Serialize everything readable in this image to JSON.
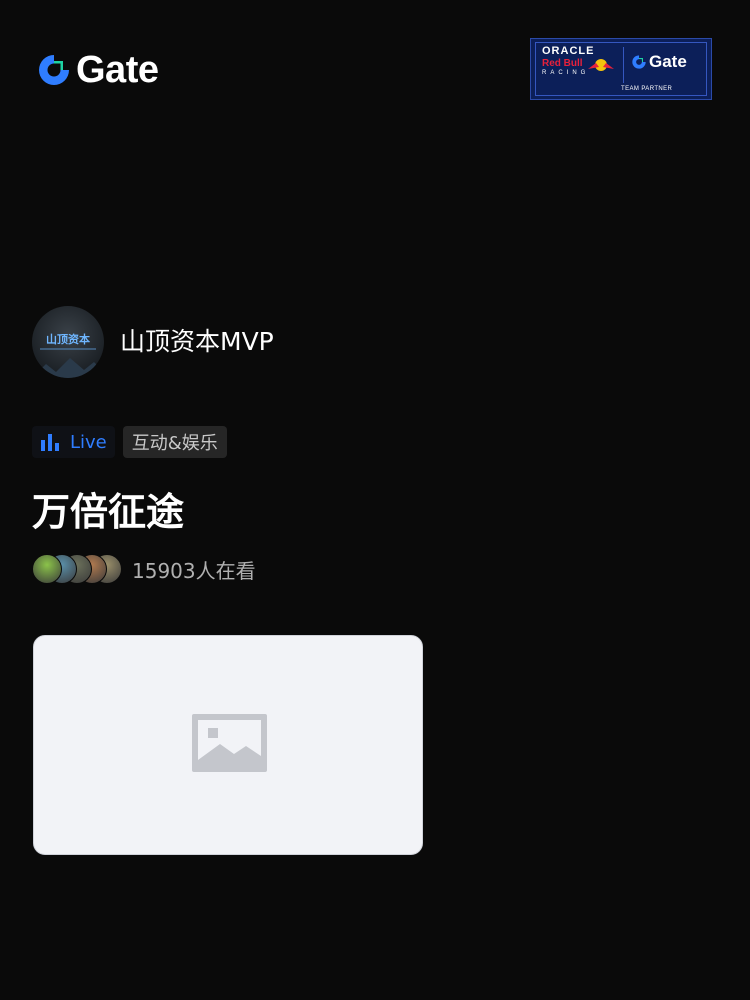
{
  "brand": {
    "name": "Gate",
    "accent": "#2f7dff",
    "mark_color": "#2f7dff",
    "mark_inner": "#1dd3a3"
  },
  "partner": {
    "oracle": "ORACLE",
    "redbull": "Red Bull",
    "racing": "RACING",
    "gate": "Gate",
    "team": "TEAM PARTNER"
  },
  "host": {
    "name": "山顶资本MVP",
    "avatar_title": "山顶资本"
  },
  "tags": {
    "live": "Live",
    "category": "互动&娱乐"
  },
  "room": {
    "title": "万倍征途"
  },
  "viewers": {
    "count_text": "15903人在看",
    "avatar_colors": [
      "#8bc34a",
      "#5a8fa8",
      "#6b705a",
      "#b07a4f",
      "#9a8f6a"
    ]
  },
  "image_card": {
    "icon": "image-placeholder-icon"
  }
}
